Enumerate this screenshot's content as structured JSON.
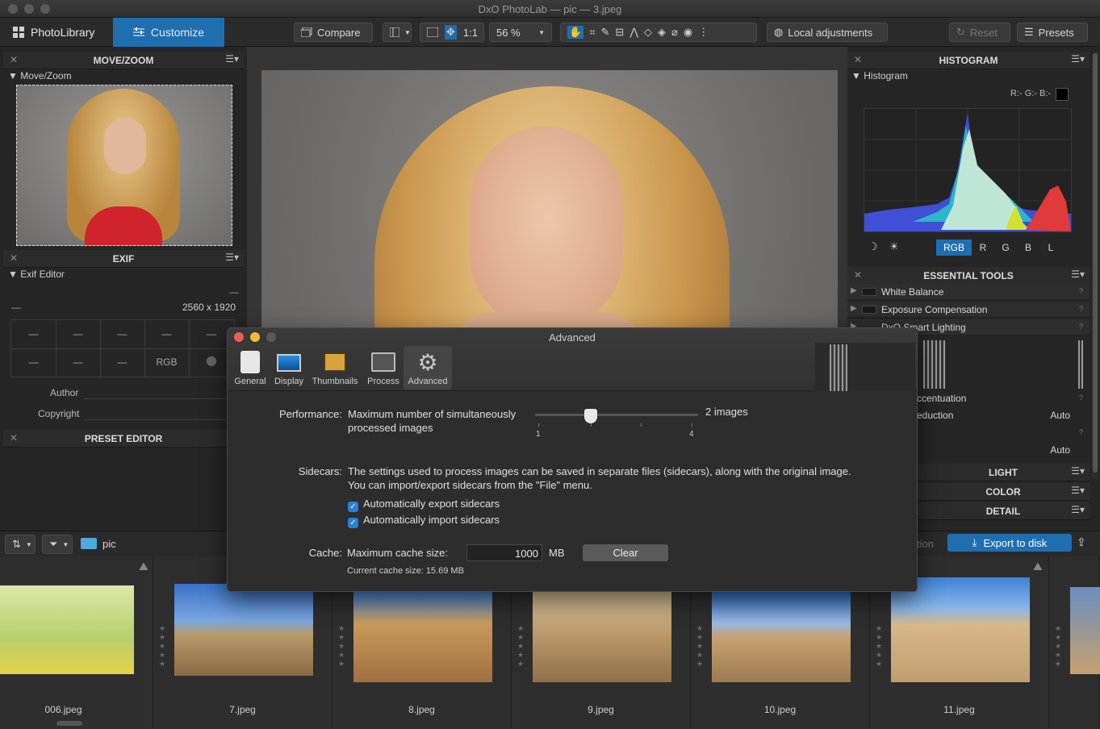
{
  "window": {
    "title": "DxO PhotoLab — pic — 3.jpeg"
  },
  "toolbar": {
    "tab_library": "PhotoLibrary",
    "tab_customize": "Customize",
    "compare": "Compare",
    "one_to_one": "1:1",
    "zoom": "56 %",
    "local_adjustments": "Local adjustments",
    "reset": "Reset",
    "presets": "Presets"
  },
  "left": {
    "movezoom_title": "MOVE/ZOOM",
    "movezoom_sub": "Move/Zoom",
    "exif_title": "EXIF",
    "exif_sub": "Exif Editor",
    "dash": "—",
    "dimensions": "2560 x 1920",
    "grid_row1": [
      "—",
      "—",
      "—",
      "—",
      "—"
    ],
    "grid_row2": [
      "—",
      "—",
      "—",
      "RGB"
    ],
    "author_label": "Author",
    "copyright_label": "Copyright",
    "preset_title": "PRESET EDITOR"
  },
  "right": {
    "histogram_title": "HISTOGRAM",
    "histogram_sub": "Histogram",
    "rgb_readout": "R:- G:- B:-",
    "channels": [
      "RGB",
      "R",
      "G",
      "B",
      "L"
    ],
    "essential_title": "ESSENTIAL TOOLS",
    "tools": [
      "White Balance",
      "Exposure Compensation",
      "DxO Smart Lighting"
    ],
    "partial_1": "ccentuation",
    "partial_2": "eduction",
    "auto": "Auto",
    "q": "?",
    "light": "LIGHT",
    "color": "COLOR",
    "detail": "DETAIL"
  },
  "filmbar": {
    "folder": "pic",
    "export": "Export to disk",
    "partial": "tion"
  },
  "filmstrip": [
    "006.jpeg",
    "7.jpeg",
    "8.jpeg",
    "9.jpeg",
    "10.jpeg",
    "11.jpeg"
  ],
  "dialog": {
    "title": "Advanced",
    "tabs": [
      "General",
      "Display",
      "Thumbnails",
      "Process",
      "Advanced"
    ],
    "perf_label": "Performance:",
    "perf_text_1": "Maximum number of simultaneously",
    "perf_text_2": "processed images",
    "slider_min": "1",
    "slider_max": "4",
    "slider_value": 2,
    "slider_readout": "2 images",
    "sidecars_label": "Sidecars:",
    "sidecars_text_1": "The settings used to process images can be saved in separate files (sidecars), along with the original image.",
    "sidecars_text_2": "You can import/export sidecars from the \"File\" menu.",
    "export_sidecars": "Automatically export sidecars",
    "import_sidecars": "Automatically import sidecars",
    "cache_label": "Cache:",
    "cache_text": "Maximum cache size:",
    "cache_value": "1000",
    "cache_unit": "MB",
    "clear": "Clear",
    "current_cache": "Current cache size: 15.69 MB"
  },
  "colors": {
    "accent": "#1f6fb0",
    "checkbox": "#2a7fd6"
  }
}
